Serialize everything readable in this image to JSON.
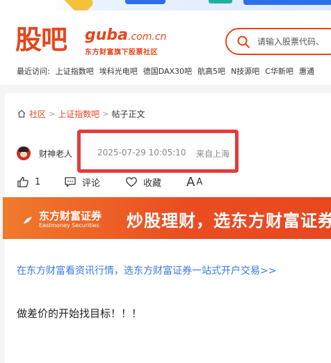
{
  "header": {
    "logo_cn": "股吧",
    "logo_en": "guba",
    "logo_domain": ".com.cn",
    "logo_tagline": "东方财富旗下股票社区",
    "search_placeholder": "请输入股票代码、",
    "recent_label": "最近访问:",
    "recent_items": [
      "上证指数吧",
      "埃科光电吧",
      "德国DAX30吧",
      "航高5吧",
      "N技源吧",
      "C华新吧",
      "惠通"
    ]
  },
  "breadcrumb": {
    "community": "社区",
    "separator": ">",
    "forum": "上证指数吧",
    "current": "帖子正文"
  },
  "post": {
    "author": "财神老人",
    "time": "2025-07-29 10:05:10",
    "location": "来自上海",
    "likes": "1",
    "comment_label": "评论",
    "favorite_label": "收藏",
    "font_large": "A",
    "font_small": "A",
    "promo_link": "在东方财富看资讯行情，选东方财富证券一站式开户交易>>",
    "body": "做差价的开始找目标！！！"
  },
  "ad": {
    "brand_cn": "东方财富证券",
    "brand_en": "Eastmoney Securities",
    "slogan": "炒股理财，选东方财富证券"
  },
  "colors": {
    "brand": "#e5461c",
    "link": "#3b7be0",
    "highlight": "#e8393c"
  }
}
